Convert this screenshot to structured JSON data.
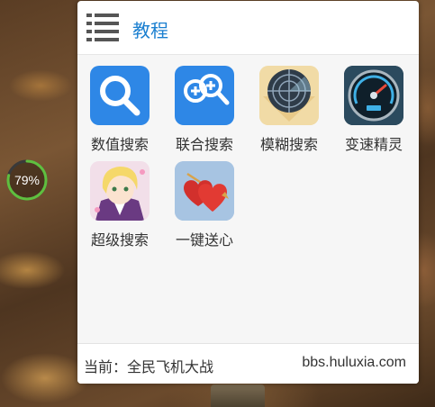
{
  "overlay": {
    "progress_text": "79%",
    "progress_value": 0.79,
    "ring_color": "#5fbf3f"
  },
  "dialog": {
    "title": "教程",
    "title_color": "#1a7fd0",
    "menu_icon": "list-icon"
  },
  "apps": [
    {
      "label": "数值搜索",
      "icon": "magnifier-icon"
    },
    {
      "label": "联合搜索",
      "icon": "combined-search-icon"
    },
    {
      "label": "模糊搜索",
      "icon": "radar-icon"
    },
    {
      "label": "变速精灵",
      "icon": "speedometer-icon"
    },
    {
      "label": "超级搜索",
      "icon": "anime-character-icon"
    },
    {
      "label": "一键送心",
      "icon": "hearts-icon"
    }
  ],
  "footer": {
    "current_game": "当前：全民飞机大战",
    "site": "bbs.huluxia.com"
  }
}
